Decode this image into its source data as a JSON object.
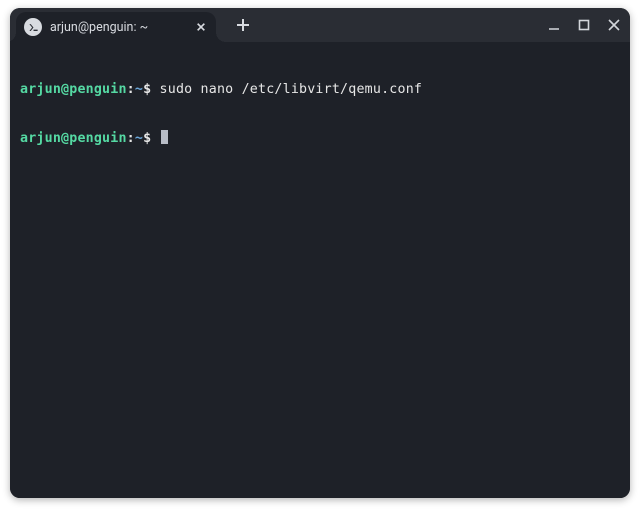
{
  "tab": {
    "title": "arjun@penguin: ~"
  },
  "terminal": {
    "lines": [
      {
        "user": "arjun@penguin",
        "sep": ":",
        "path": "~",
        "dollar": "$ ",
        "command": "sudo nano /etc/libvirt/qemu.conf"
      },
      {
        "user": "arjun@penguin",
        "sep": ":",
        "path": "~",
        "dollar": "$ ",
        "command": ""
      }
    ]
  }
}
